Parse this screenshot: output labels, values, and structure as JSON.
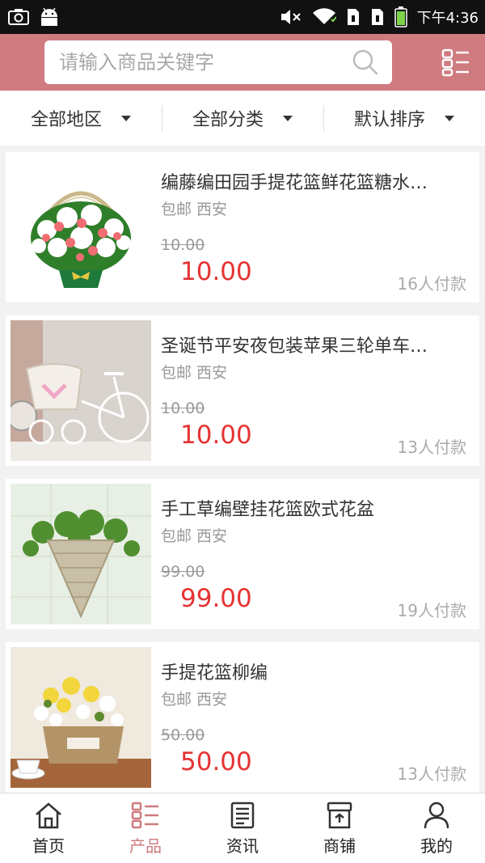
{
  "status_bar": {
    "time": "下午4:36",
    "left_icons": [
      "screenshot-icon",
      "android-icon"
    ],
    "right_icons": [
      "mute-icon",
      "wifi-icon",
      "sim1-icon",
      "sim2-icon",
      "battery-icon"
    ]
  },
  "header": {
    "search_placeholder": "请输入商品关键字",
    "accent_color": "#cf7b7f",
    "search_icon": "search-icon",
    "menu_icon": "list-menu-icon"
  },
  "filters": [
    {
      "label": "全部地区"
    },
    {
      "label": "全部分类"
    },
    {
      "label": "默认排序"
    }
  ],
  "products": [
    {
      "title": "编藤编田园手提花篮鲜花篮糖水…",
      "shipping": "包邮",
      "location": "西安",
      "original_price": "10.00",
      "price": "10.00",
      "sold": "16人付款",
      "image": "flower-basket-photo"
    },
    {
      "title": "圣诞节平安夜包装苹果三轮单车…",
      "shipping": "包邮",
      "location": "西安",
      "original_price": "10.00",
      "price": "10.00",
      "sold": "13人付款",
      "image": "tricycle-basket-photo"
    },
    {
      "title": "手工草编壁挂花篮欧式花盆",
      "shipping": "包邮",
      "location": "西安",
      "original_price": "99.00",
      "price": "99.00",
      "sold": "19人付款",
      "image": "hanging-basket-photo"
    },
    {
      "title": "手提花篮柳编",
      "shipping": "包邮",
      "location": "西安",
      "original_price": "50.00",
      "price": "50.00",
      "sold": "13人付款",
      "image": "wicker-basket-photo"
    }
  ],
  "bottom_nav": [
    {
      "label": "首页",
      "icon": "home-icon",
      "active": false
    },
    {
      "label": "产品",
      "icon": "product-grid-icon",
      "active": true
    },
    {
      "label": "资讯",
      "icon": "news-icon",
      "active": false
    },
    {
      "label": "商铺",
      "icon": "shop-icon",
      "active": false
    },
    {
      "label": "我的",
      "icon": "user-icon",
      "active": false
    }
  ],
  "colors": {
    "price": "#e53333",
    "accent": "#cf7b7f",
    "status_bar": "#111111"
  }
}
